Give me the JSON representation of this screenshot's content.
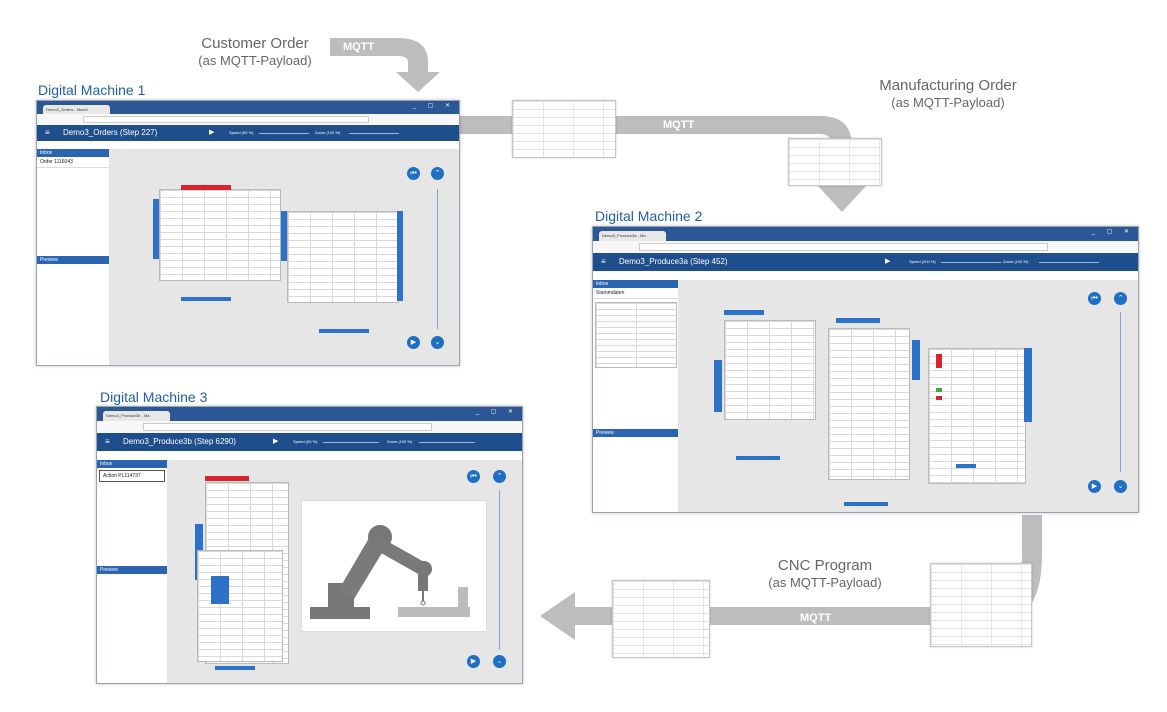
{
  "labels": {
    "customer_order": "Customer Order",
    "customer_order_sub": "(as MQTT-Payload)",
    "manufacturing_order": "Manufacturing Order",
    "manufacturing_order_sub": "(as MQTT-Payload)",
    "cnc_program": "CNC Program",
    "cnc_program_sub": "(as MQTT-Payload)",
    "mqtt": "MQTT"
  },
  "machines": [
    {
      "heading": "Digital Machine 1",
      "tab": "Demo3_Orders - Machi",
      "app_title": "Demo3_Orders (Step 227)",
      "sidebar_header": "Inbox",
      "sidebar_row": "Order  1116043",
      "preview": "Preview",
      "speed": "Speed (50 %)",
      "zoom": "Zoom (100 %)"
    },
    {
      "heading": "Digital Machine 2",
      "tab": "Demo3_Produce3a - Ma",
      "app_title": "Demo3_Produce3a (Step 452)",
      "sidebar_header": "Inbox",
      "sidebar_row": "Stammdaten",
      "preview": "Preview",
      "speed": "Speed (200 %)",
      "zoom": "Zoom (100 %)"
    },
    {
      "heading": "Digital Machine 3",
      "tab": "Demo3_Produce3b - Ma",
      "app_title": "Demo3_Produce3b (Step 6290)",
      "sidebar_header": "Inbox",
      "sidebar_row": "Action  PL114737",
      "preview": "Preview",
      "speed": "Speed (50 %)",
      "zoom": "Zoom (100 %)"
    }
  ],
  "colors": {
    "arrow_grey": "#bdbdbd",
    "app_blue": "#1f4e8c",
    "heading_blue": "#1f5fa8",
    "accent_red": "#d9232d"
  }
}
